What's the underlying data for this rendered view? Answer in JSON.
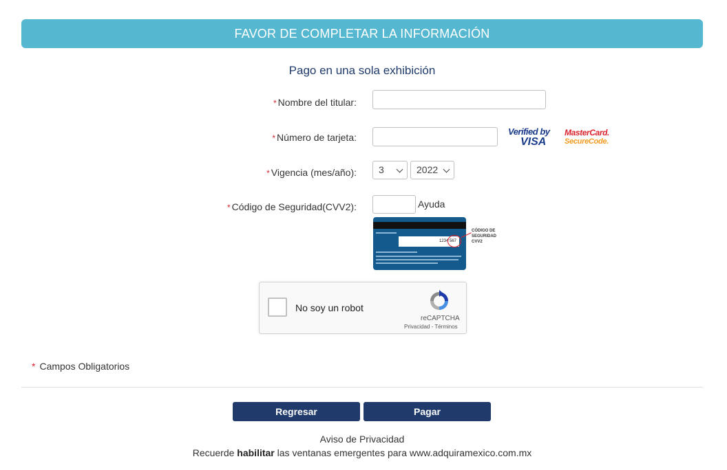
{
  "header": {
    "title": "FAVOR DE COMPLETAR LA INFORMACIÓN"
  },
  "payment_mode": "Pago en una sola exhibición",
  "required_marker": "*",
  "fields": {
    "holder": {
      "label": "Nombre del titular:",
      "value": ""
    },
    "card_number": {
      "label": "Número de tarjeta:",
      "value": ""
    },
    "expiry": {
      "label": "Vigencia (mes/año):",
      "month": "3",
      "year": "2022"
    },
    "cvv": {
      "label": "Código de Seguridad(CVV2):",
      "value": "",
      "help_label": "Ayuda"
    }
  },
  "brands": {
    "visa": {
      "line1": "Verified by",
      "line2": "VISA"
    },
    "mastercard": {
      "line1": "MasterCard.",
      "line2": "SecureCode."
    }
  },
  "cvv_image": {
    "note_line1": "CÓDIGO DE",
    "note_line2": "SEGURIDAD",
    "note_line3": "CVV2",
    "digits": "1234 567"
  },
  "captcha": {
    "label": "No soy un robot",
    "brand": "reCAPTCHA",
    "terms": "Privacidad - Términos"
  },
  "required_note": "Campos Obligatorios",
  "buttons": {
    "back": "Regresar",
    "pay": "Pagar"
  },
  "footer": {
    "privacy": "Aviso de Privacidad",
    "popup_prefix": "Recuerde ",
    "popup_bold": "habilitar",
    "popup_suffix": " las ventanas emergentes para www.adquiramexico.com.mx"
  },
  "colors": {
    "accent": "#56b8d0",
    "primary": "#1f3a6b",
    "required": "#d9232d"
  }
}
